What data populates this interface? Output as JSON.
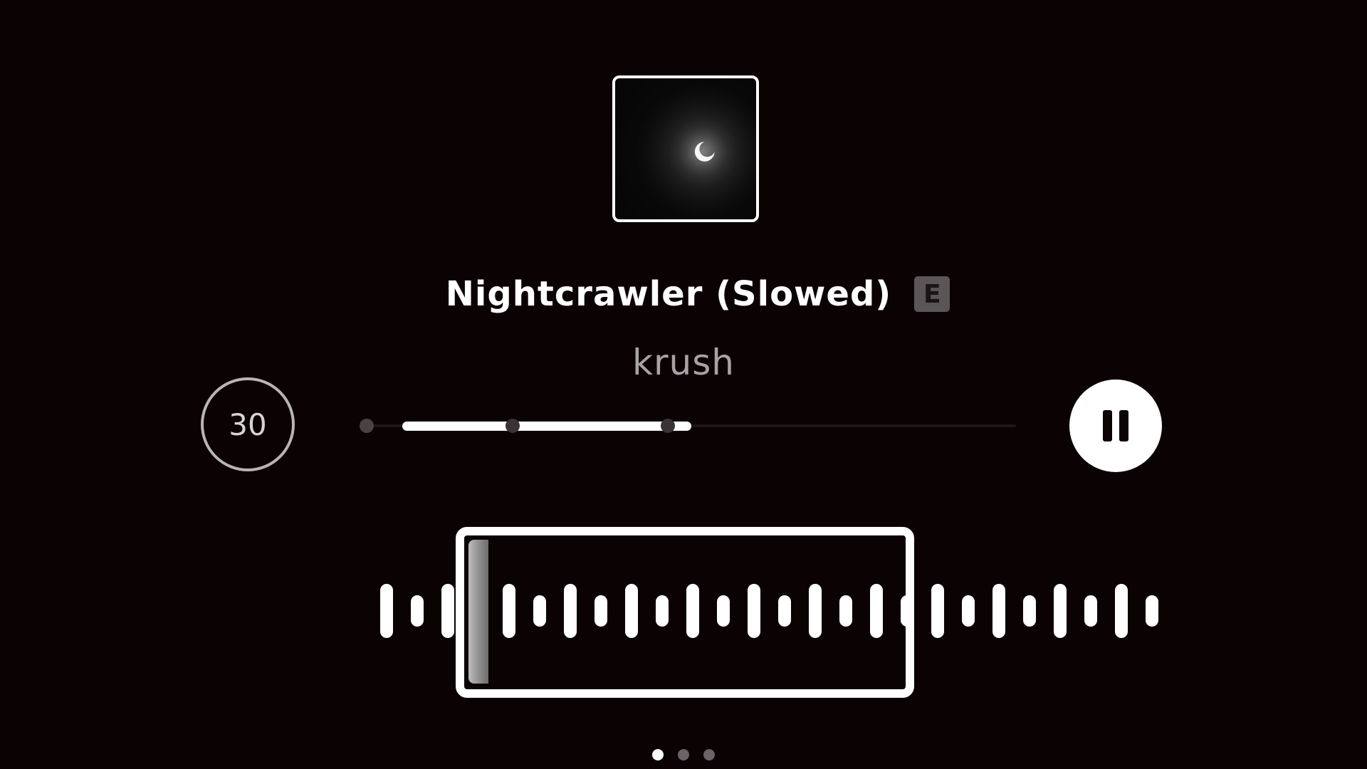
{
  "track": {
    "title": "Nightcrawler (Slowed)",
    "explicit_badge": "E",
    "artist": "krush"
  },
  "controls": {
    "skip_label": "30",
    "pause_icon": "pause-icon",
    "progress_fraction": 0.44
  },
  "pager": {
    "count": 3,
    "active_index": 0
  },
  "colors": {
    "background": "#0b0204",
    "foreground": "#ffffff",
    "secondary_text": "#a8a4a6"
  }
}
